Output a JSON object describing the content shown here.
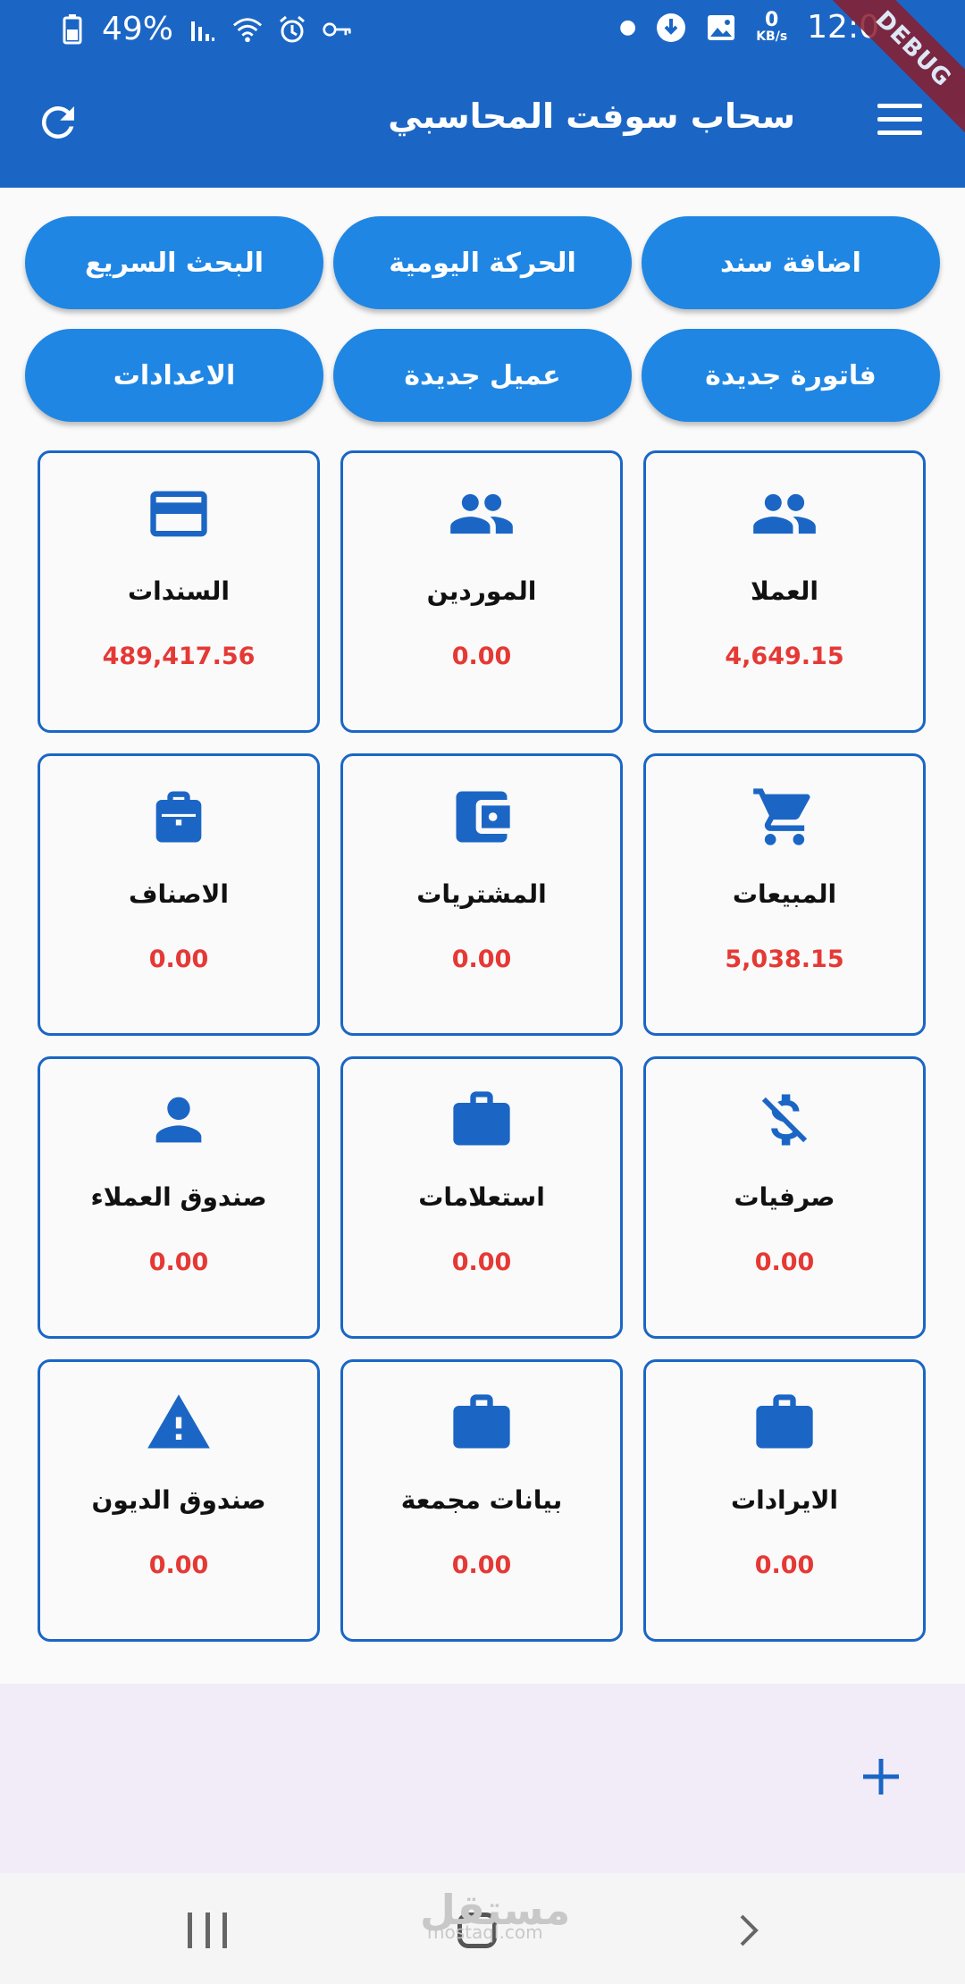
{
  "status_bar": {
    "battery": "49%",
    "time": "12:0",
    "net_speed_value": "0",
    "net_speed_unit": "KB/s",
    "debug_banner": "DEBUG"
  },
  "app_bar": {
    "title": "سحاب سوفت المحاسبي",
    "refresh_icon": "refresh-icon",
    "menu_icon": "menu-icon"
  },
  "quick_actions": [
    {
      "label": "اضافة سند"
    },
    {
      "label": "الحركة اليومية"
    },
    {
      "label": "البحث السريع"
    },
    {
      "label": "فاتورة جديدة"
    },
    {
      "label": "عميل جديدة"
    },
    {
      "label": "الاعدادات"
    }
  ],
  "cards": [
    {
      "label": "العملا",
      "value": "4,649.15",
      "icon": "people-icon"
    },
    {
      "label": "الموردين",
      "value": "0.00",
      "icon": "people-icon"
    },
    {
      "label": "السندات",
      "value": "489,417.56",
      "icon": "credit-card-icon"
    },
    {
      "label": "المبيعات",
      "value": "5,038.15",
      "icon": "cart-icon"
    },
    {
      "label": "المشتريات",
      "value": "0.00",
      "icon": "wallet-icon"
    },
    {
      "label": "الاصناف",
      "value": "0.00",
      "icon": "bag-icon"
    },
    {
      "label": "صرفيات",
      "value": "0.00",
      "icon": "money-off-icon"
    },
    {
      "label": "استعلامات",
      "value": "0.00",
      "icon": "briefcase-icon"
    },
    {
      "label": "صندوق العملاء",
      "value": "0.00",
      "icon": "person-icon"
    },
    {
      "label": "الايرادات",
      "value": "0.00",
      "icon": "briefcase-icon"
    },
    {
      "label": "بيانات مجمعة",
      "value": "0.00",
      "icon": "briefcase-icon"
    },
    {
      "label": "صندوق الديون",
      "value": "0.00",
      "icon": "warning-icon"
    }
  ],
  "watermark": {
    "text": "مستقل",
    "sub": "mostaql.com"
  },
  "colors": {
    "primary": "#1b66c5",
    "button": "#1f86e4",
    "value": "#e53935",
    "bottom_panel": "#f2ecf8"
  }
}
